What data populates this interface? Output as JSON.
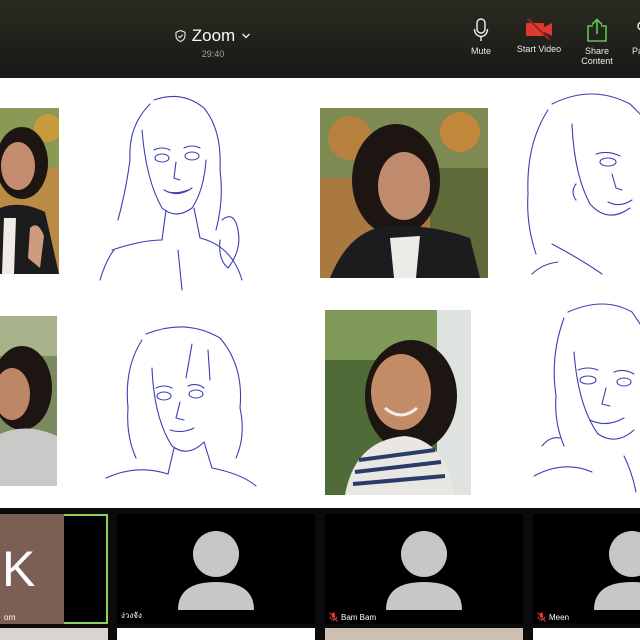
{
  "meeting": {
    "title": "Zoom",
    "timer": "29:40"
  },
  "toolbar": {
    "mute_label": "Mute",
    "start_video_label": "Start Video",
    "share_content_label": "Share Content",
    "more_label": "Pa"
  },
  "colors": {
    "toolbar_bg": "#23221c",
    "video_off_red": "#e0372f",
    "share_green": "#5fc45a",
    "active_speaker_border": "#8fd15e",
    "mic_muted_red": "#e0372f",
    "sketch_ink": "#3b3fb5"
  },
  "participants": [
    {
      "name": "orn",
      "initial": "K",
      "active": true,
      "muted": false
    },
    {
      "name": "ง่วงจัง",
      "active": false,
      "muted": false
    },
    {
      "name": "Bam Bam",
      "active": false,
      "muted": true
    },
    {
      "name": "Meen",
      "active": false,
      "muted": true
    }
  ]
}
